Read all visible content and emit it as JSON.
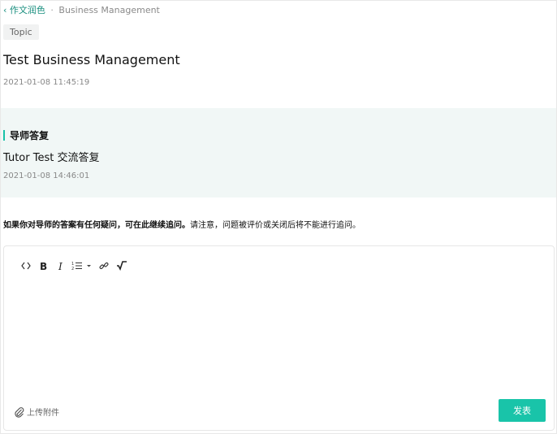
{
  "breadcrumb": {
    "back_label": "‹ 作文润色",
    "separator": "·",
    "current": "Business Management"
  },
  "topic": {
    "tag": "Topic",
    "title": "Test Business Management",
    "date": "2021-01-08 11:45:19"
  },
  "answer": {
    "heading": "导师答复",
    "body": "Tutor Test 交流答复",
    "date": "2021-01-08 14:46:01",
    "accent_color": "#18c2a8",
    "background_color": "#f1f7f6"
  },
  "notice": {
    "bold": "如果你对导师的答案有任何疑问，可在此继续追问。",
    "normal": "请注意，问题被评价或关闭后将不能进行追问。"
  },
  "editor": {
    "toolbar": [
      {
        "icon": "code-icon"
      },
      {
        "icon": "bold-icon"
      },
      {
        "icon": "italic-icon"
      },
      {
        "icon": "ordered-list-icon"
      },
      {
        "icon": "link-icon"
      },
      {
        "icon": "formula-icon"
      }
    ],
    "content": "",
    "upload_label": "上传附件",
    "submit_label": "发表",
    "submit_color": "#19c4a9"
  }
}
